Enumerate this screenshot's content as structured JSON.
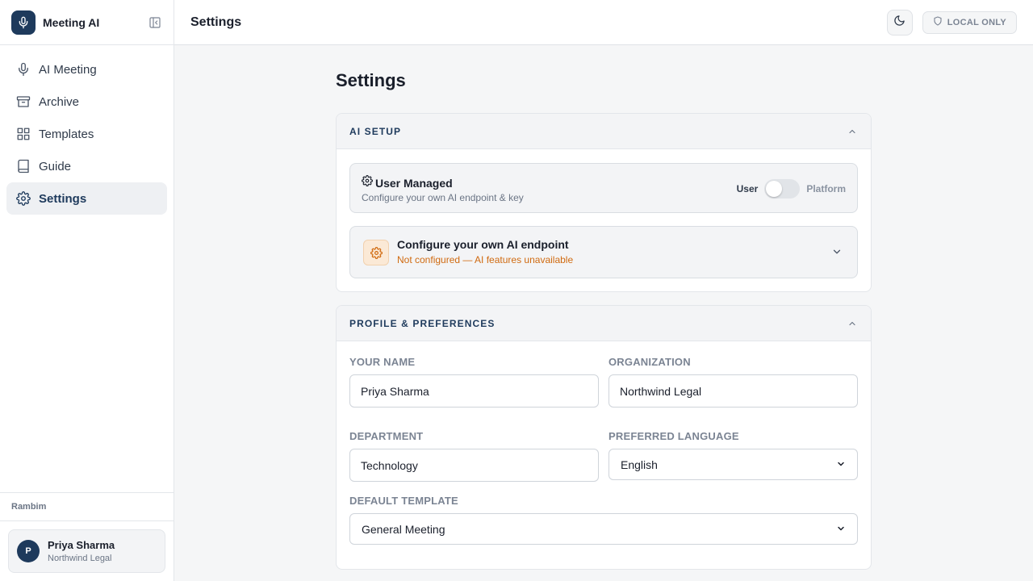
{
  "app": {
    "name": "Meeting AI"
  },
  "sidebar": {
    "items": [
      {
        "label": "AI Meeting",
        "icon": "microphone-icon"
      },
      {
        "label": "Archive",
        "icon": "archive-box-icon"
      },
      {
        "label": "Templates",
        "icon": "grid-icon"
      },
      {
        "label": "Guide",
        "icon": "book-icon"
      },
      {
        "label": "Settings",
        "icon": "gear-icon",
        "active": true
      }
    ],
    "workspace": "Rambim",
    "user": {
      "initial": "P",
      "name": "Priya Sharma",
      "org": "Northwind Legal"
    }
  },
  "header": {
    "title": "Settings",
    "badge": "LOCAL ONLY",
    "theme_icon": "moon-icon"
  },
  "page": {
    "title": "Settings"
  },
  "ai_setup": {
    "title": "AI SETUP",
    "mode": {
      "title": "User Managed",
      "subtitle": "Configure your own AI endpoint & key",
      "toggle_left": "User",
      "toggle_right": "Platform",
      "toggle_state": "User"
    },
    "endpoint": {
      "title": "Configure your own AI endpoint",
      "status": "Not configured — AI features unavailable"
    }
  },
  "profile": {
    "title": "PROFILE & PREFERENCES",
    "name_label": "YOUR NAME",
    "name_value": "Priya Sharma",
    "org_label": "ORGANIZATION",
    "org_value": "Northwind Legal",
    "dept_label": "DEPARTMENT",
    "dept_value": "Technology",
    "lang_label": "PREFERRED LANGUAGE",
    "lang_value": "English",
    "template_label": "DEFAULT TEMPLATE",
    "template_value": "General Meeting"
  },
  "colors": {
    "brand": "#1e3a5c",
    "warning": "#d06a10",
    "sidebar_active_bg": "#eef0f3"
  }
}
